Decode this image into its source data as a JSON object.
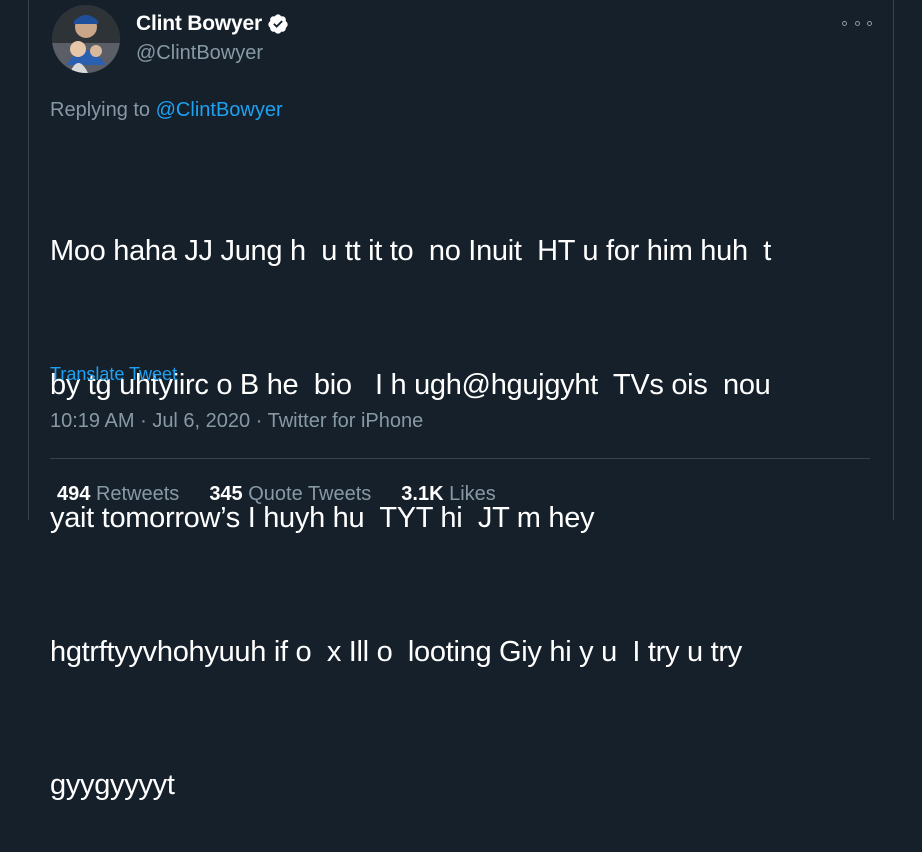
{
  "author": {
    "display_name": "Clint Bowyer",
    "handle": "@ClintBowyer",
    "verified": true
  },
  "reply": {
    "prefix": "Replying to",
    "target": "@ClintBowyer"
  },
  "tweet": {
    "text": "Moo haha JJ Jung h  u tt it to  no Inuit  HT u for him huh  t by tg uhtyiirc o B he  bio   I h ugh@hgujgyht  TVs ois  nou yait tomorrow’s I huyh hu  TYT hi  JT m hey hgtrftyyvhohyuuh if o  x Ill o  looting Giy hi y u  I try u try gyygyyyyt",
    "lines": [
      "Moo haha JJ Jung h  u tt it to  no Inuit  HT u for him huh  t",
      "by tg uhtyiirc o B he  bio   I h ugh@hgujgyht  TVs ois  nou",
      "yait tomorrow’s I huyh hu  TYT hi  JT m hey",
      "hgtrftyyvhohyuuh if o  x Ill o  looting Giy hi y u  I try u try",
      "gyygyyyyt"
    ],
    "translate_label": "Translate Tweet"
  },
  "meta": {
    "time": "10:19 AM",
    "date": "Jul 6, 2020",
    "source": "Twitter for iPhone",
    "separator": "·"
  },
  "stats": {
    "retweets_count": "494",
    "retweets_label": "Retweets",
    "quotes_count": "345",
    "quotes_label": "Quote Tweets",
    "likes_count": "3.1K",
    "likes_label": "Likes"
  },
  "icons": {
    "verified": "verified-badge-icon",
    "more": "more-options-icon"
  },
  "colors": {
    "background": "#15202b",
    "accent": "#1da1f2",
    "secondary_text": "#8899a6",
    "border": "#38444d"
  }
}
